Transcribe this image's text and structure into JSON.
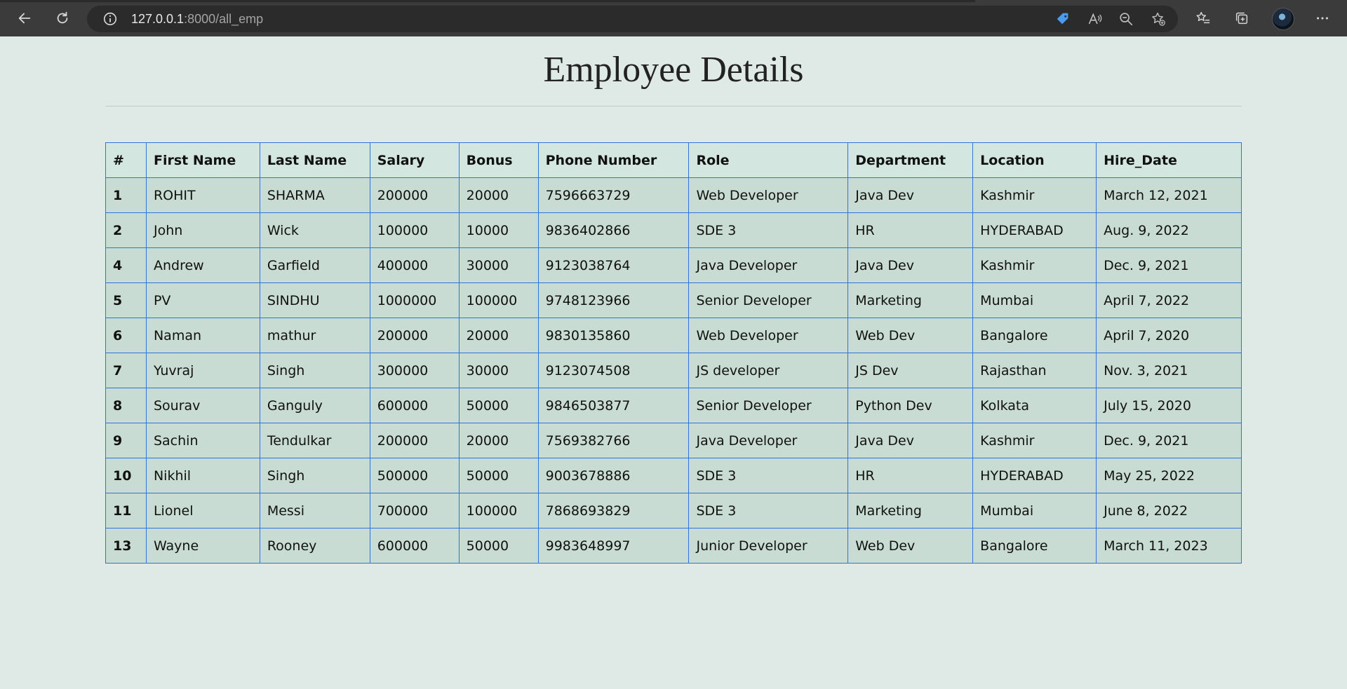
{
  "browser": {
    "url_host": "127.0.0.1",
    "url_path": ":8000/all_emp"
  },
  "page": {
    "title": "Employee Details"
  },
  "table": {
    "headers": [
      "#",
      "First Name",
      "Last Name",
      "Salary",
      "Bonus",
      "Phone Number",
      "Role",
      "Department",
      "Location",
      "Hire_Date"
    ],
    "rows": [
      [
        "1",
        "ROHIT",
        "SHARMA",
        "200000",
        "20000",
        "7596663729",
        "Web Developer",
        "Java Dev",
        "Kashmir",
        "March 12, 2021"
      ],
      [
        "2",
        "John",
        "Wick",
        "100000",
        "10000",
        "9836402866",
        "SDE 3",
        "HR",
        "HYDERABAD",
        "Aug. 9, 2022"
      ],
      [
        "4",
        "Andrew",
        "Garfield",
        "400000",
        "30000",
        "9123038764",
        "Java Developer",
        "Java Dev",
        "Kashmir",
        "Dec. 9, 2021"
      ],
      [
        "5",
        "PV",
        "SINDHU",
        "1000000",
        "100000",
        "9748123966",
        "Senior Developer",
        "Marketing",
        "Mumbai",
        "April 7, 2022"
      ],
      [
        "6",
        "Naman",
        "mathur",
        "200000",
        "20000",
        "9830135860",
        "Web Developer",
        "Web Dev",
        "Bangalore",
        "April 7, 2020"
      ],
      [
        "7",
        "Yuvraj",
        "Singh",
        "300000",
        "30000",
        "9123074508",
        "JS developer",
        "JS Dev",
        "Rajasthan",
        "Nov. 3, 2021"
      ],
      [
        "8",
        "Sourav",
        "Ganguly",
        "600000",
        "50000",
        "9846503877",
        "Senior Developer",
        "Python Dev",
        "Kolkata",
        "July 15, 2020"
      ],
      [
        "9",
        "Sachin",
        "Tendulkar",
        "200000",
        "20000",
        "7569382766",
        "Java Developer",
        "Java Dev",
        "Kashmir",
        "Dec. 9, 2021"
      ],
      [
        "10",
        "Nikhil",
        "Singh",
        "500000",
        "50000",
        "9003678886",
        "SDE 3",
        "HR",
        "HYDERABAD",
        "May 25, 2022"
      ],
      [
        "11",
        "Lionel",
        "Messi",
        "700000",
        "100000",
        "7868693829",
        "SDE 3",
        "Marketing",
        "Mumbai",
        "June 8, 2022"
      ],
      [
        "13",
        "Wayne",
        "Rooney",
        "600000",
        "50000",
        "9983648997",
        "Junior Developer",
        "Web Dev",
        "Bangalore",
        "March 11, 2023"
      ]
    ]
  }
}
